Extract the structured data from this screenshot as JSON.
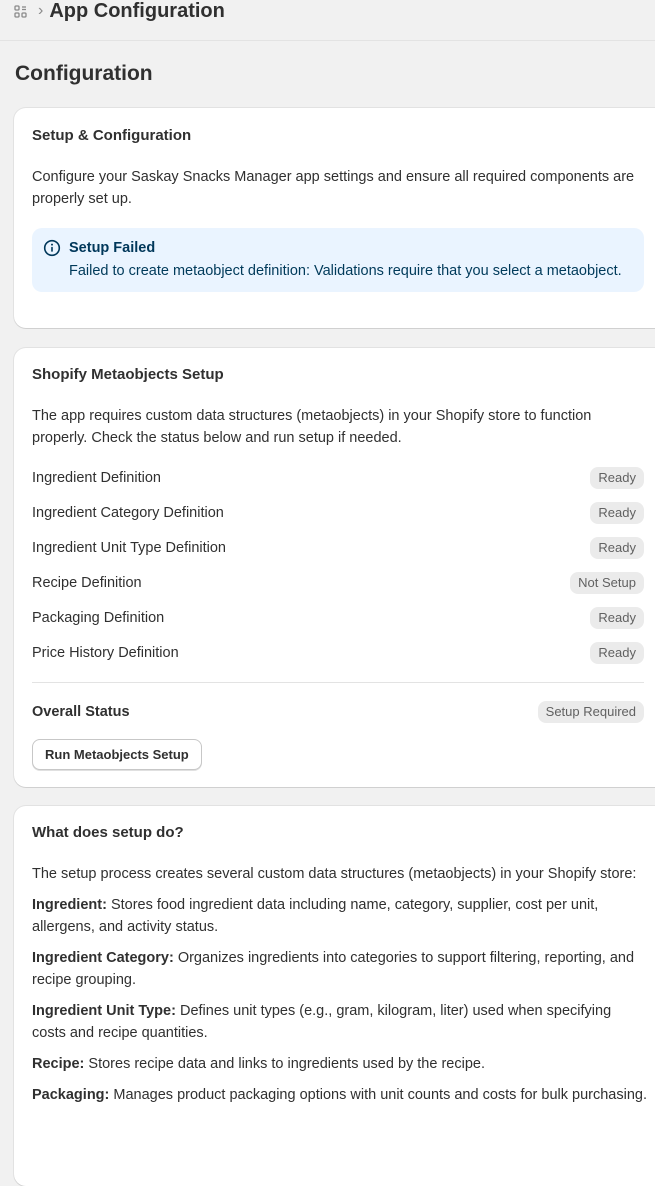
{
  "breadcrumb": {
    "title": "App Configuration"
  },
  "page": {
    "title": "Configuration"
  },
  "setup_card": {
    "title": "Setup & Configuration",
    "description": "Configure your Saskay Snacks Manager app settings and ensure all required components are properly set up.",
    "banner": {
      "title": "Setup Failed",
      "message": "Failed to create metaobject definition: Validations require that you select a metaobject."
    }
  },
  "metaobjects_card": {
    "title": "Shopify Metaobjects Setup",
    "description": "The app requires custom data structures (metaobjects) in your Shopify store to function properly. Check the status below and run setup if needed.",
    "rows": [
      {
        "label": "Ingredient Definition",
        "status": "Ready"
      },
      {
        "label": "Ingredient Category Definition",
        "status": "Ready"
      },
      {
        "label": "Ingredient Unit Type Definition",
        "status": "Ready"
      },
      {
        "label": "Recipe Definition",
        "status": "Not Setup"
      },
      {
        "label": "Packaging Definition",
        "status": "Ready"
      },
      {
        "label": "Price History Definition",
        "status": "Ready"
      }
    ],
    "overall_label": "Overall Status",
    "overall_status": "Setup Required",
    "run_button": "Run Metaobjects Setup"
  },
  "info_card": {
    "title": "What does setup do?",
    "intro": "The setup process creates several custom data structures (metaobjects) in your Shopify store:",
    "items": [
      {
        "term": "Ingredient:",
        "text": " Stores food ingredient data including name, category, supplier, cost per unit, allergens, and activity status."
      },
      {
        "term": "Ingredient Category:",
        "text": " Organizes ingredients into categories to support filtering, reporting, and recipe grouping."
      },
      {
        "term": "Ingredient Unit Type:",
        "text": " Defines unit types (e.g., gram, kilogram, liter) used when specifying costs and recipe quantities."
      },
      {
        "term": "Recipe:",
        "text": " Stores recipe data and links to ingredients used by the recipe."
      },
      {
        "term": "Packaging:",
        "text": " Manages product packaging options with unit counts and costs for bulk purchasing."
      }
    ]
  }
}
